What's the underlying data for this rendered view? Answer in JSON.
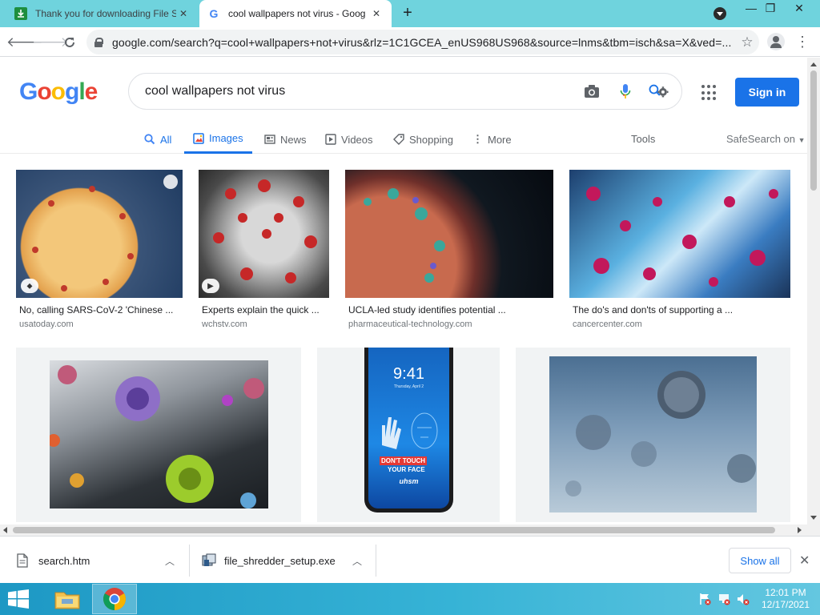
{
  "browser": {
    "tabs": [
      {
        "title": "Thank you for downloading File S",
        "favicon": "green-download-icon",
        "active": false
      },
      {
        "title": "cool wallpapers not virus - Goog",
        "favicon": "google-g-icon",
        "active": true
      }
    ],
    "new_tab": "+",
    "window_controls": {
      "minimize": "—",
      "restore": "❐",
      "close": "✕"
    },
    "url": "google.com/search?q=cool+wallpapers+not+virus&rlz=1C1GCEA_enUS968US968&source=lnms&tbm=isch&sa=X&ved=...",
    "menu": "⋮"
  },
  "google": {
    "logo_letters": [
      "G",
      "o",
      "o",
      "g",
      "l",
      "e"
    ],
    "logo_colors": [
      "#4285f4",
      "#ea4335",
      "#fbbc05",
      "#4285f4",
      "#34a853",
      "#ea4335"
    ],
    "query": "cool wallpapers not virus",
    "sign_in": "Sign in",
    "search_tabs": [
      {
        "label": "All",
        "icon": "search-icon",
        "selected": false
      },
      {
        "label": "Images",
        "icon": "image-icon",
        "selected": true
      },
      {
        "label": "News",
        "icon": "news-icon",
        "selected": false
      },
      {
        "label": "Videos",
        "icon": "video-icon",
        "selected": false
      },
      {
        "label": "Shopping",
        "icon": "tag-icon",
        "selected": false
      },
      {
        "label": "More",
        "icon": "more-vert-icon",
        "selected": false
      }
    ],
    "tools": "Tools",
    "safesearch": "SafeSearch on",
    "results": [
      {
        "caption": "No, calling SARS-CoV-2 'Chinese ...",
        "source": "usatoday.com",
        "badge": "tag-icon"
      },
      {
        "caption": "Experts explain the quick ...",
        "source": "wchstv.com",
        "badge": "play-icon"
      },
      {
        "caption": "UCLA-led study identifies potential ...",
        "source": "pharmaceutical-technology.com",
        "badge": ""
      },
      {
        "caption": "The do's and don'ts of supporting a ...",
        "source": "cancercenter.com",
        "badge": ""
      },
      {
        "caption": "",
        "source": "",
        "badge": ""
      },
      {
        "caption": "",
        "source": "",
        "badge": ""
      },
      {
        "caption": "",
        "source": "",
        "badge": ""
      }
    ],
    "phone": {
      "time": "9:41",
      "date": "Thursday, April 2",
      "line1": "DON'T TOUCH",
      "line2": "YOUR FACE",
      "brand": "uhsm"
    }
  },
  "downloads": {
    "items": [
      {
        "name": "search.htm",
        "icon": "document-icon"
      },
      {
        "name": "file_shredder_setup.exe",
        "icon": "installer-icon"
      }
    ],
    "show_all": "Show all",
    "close": "✕"
  },
  "taskbar": {
    "time": "12:01 PM",
    "date": "12/17/2021"
  }
}
